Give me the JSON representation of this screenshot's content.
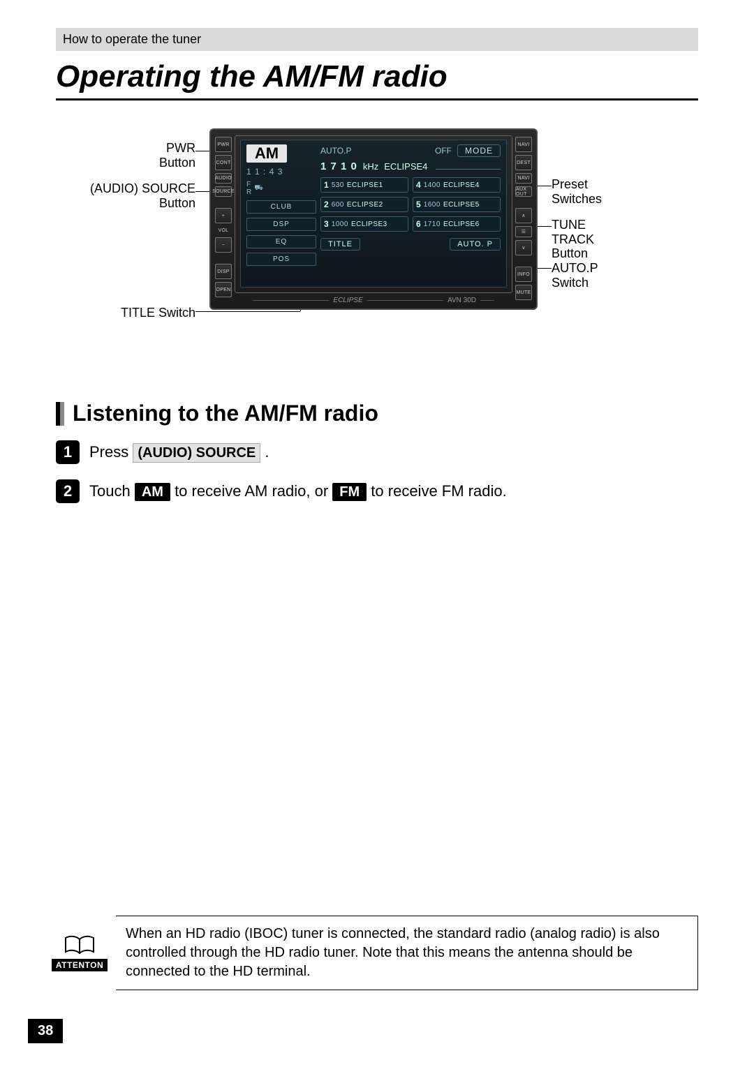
{
  "breadcrumb": "How to operate the tuner",
  "page_title": "Operating the AM/FM radio",
  "page_number": "38",
  "diagram": {
    "labels_left": [
      {
        "text": "PWR\nButton"
      },
      {
        "text": "(AUDIO) SOURCE\nButton"
      },
      {
        "text": "TITLE Switch"
      }
    ],
    "labels_right": [
      {
        "text": "Preset\nSwitches"
      },
      {
        "text": "TUNE TRACK\nButton"
      },
      {
        "text": "AUTO.P\nSwitch"
      }
    ],
    "left_side_buttons": [
      "PWR",
      "CONT",
      "AUDIO",
      "SOURCE",
      "",
      "+",
      "VOL",
      "−",
      "",
      "DISP",
      "OPEN"
    ],
    "right_side_buttons": [
      "NAVI",
      "DEST",
      "NAVI",
      "AUX OUT",
      "",
      "∧",
      "☰",
      "∨",
      "",
      "INFO",
      "MUTE"
    ],
    "screen": {
      "band": "AM",
      "time": "1 1 : 4 3",
      "fr_label": "F\nR",
      "loud_icon": "⛟",
      "club_label": "CLUB",
      "dsp_label": "DSP",
      "eq_label": "EQ",
      "pos_label": "POS",
      "title_label": "TITLE",
      "autop_label": "AUTO. P",
      "header_auto_p": "AUTO.P",
      "header_off": "OFF",
      "header_mode": "MODE",
      "freq_value": "1 7 1 0",
      "freq_unit": "kHz",
      "station_name": "ECLIPSE4",
      "presets": [
        {
          "num": "1",
          "freq": "530",
          "name": "ECLIPSE1"
        },
        {
          "num": "4",
          "freq": "1400",
          "name": "ECLIPSE4"
        },
        {
          "num": "2",
          "freq": "600",
          "name": "ECLIPSE2"
        },
        {
          "num": "5",
          "freq": "1600",
          "name": "ECLIPSE5"
        },
        {
          "num": "3",
          "freq": "1000",
          "name": "ECLIPSE3"
        },
        {
          "num": "6",
          "freq": "1710",
          "name": "ECLIPSE6"
        }
      ],
      "brand": "ECLIPSE",
      "model": "AVN 30D"
    }
  },
  "section_title": "Listening to the AM/FM radio",
  "steps": {
    "s1": {
      "num": "1",
      "pre": "Press ",
      "key": "(AUDIO) SOURCE",
      "post": "."
    },
    "s2": {
      "num": "2",
      "pre": "Touch ",
      "k1": "AM",
      "mid": " to receive AM radio, or ",
      "k2": "FM",
      "post": " to receive FM radio."
    }
  },
  "attention": {
    "label": "ATTENTON",
    "text": "When an HD radio (IBOC) tuner is connected, the standard radio (analog radio) is also controlled through the HD radio tuner.  Note that this means the antenna should be connected to the HD terminal."
  }
}
